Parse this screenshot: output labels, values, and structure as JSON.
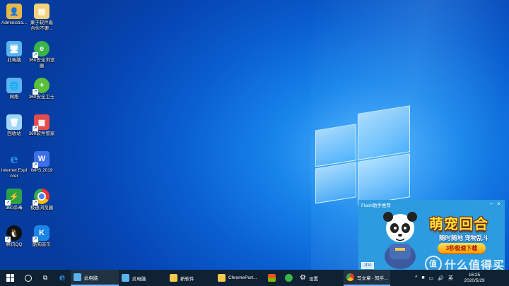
{
  "desktop_icons": [
    {
      "label": "Administra...",
      "icon": "user-folder-icon",
      "color": "#e8b84a"
    },
    {
      "label": "果子软件着 合伙不要...",
      "icon": "folder-icon",
      "color": "#f2d27a"
    },
    {
      "label": "此电脑",
      "icon": "computer-icon",
      "color": "#5ab4f0"
    },
    {
      "label": "360安全浏览器",
      "icon": "browser-360-icon",
      "color": "#3bb54a"
    },
    {
      "label": "网络",
      "icon": "network-icon",
      "color": "#5ab4f0"
    },
    {
      "label": "360安全卫士",
      "icon": "security-360-icon",
      "color": "#58c03a"
    },
    {
      "label": "回收站",
      "icon": "recycle-bin-icon",
      "color": "#9fd6f7"
    },
    {
      "label": "360软件管家",
      "icon": "software-manager-icon",
      "color": "#e64b4b"
    },
    {
      "label": "Internet Explorer",
      "icon": "ie-icon",
      "color": "#2a8de0"
    },
    {
      "label": "WPS 2019",
      "icon": "wps-icon",
      "color": "#3d6fe8"
    },
    {
      "label": "360杀毒",
      "icon": "antivirus-icon",
      "color": "#2fa04a"
    },
    {
      "label": "极速浏览器",
      "icon": "chrome-icon",
      "color": "#e5a823"
    },
    {
      "label": "腾讯QQ",
      "icon": "qq-icon",
      "color": "#111111"
    },
    {
      "label": "酷狗音乐",
      "icon": "kugou-icon",
      "color": "#1b85e5"
    }
  ],
  "popup": {
    "title": "Flash助手推荐",
    "logo_text": "萌宠回合",
    "subtitle": "随时随地 宠物乱斗",
    "button": "3秒极速下载",
    "badge": "1110",
    "close_icon": "close-icon",
    "minimize_icon": "minimize-icon"
  },
  "taskbar": {
    "items": [
      {
        "label": "此电脑",
        "icon": "computer-icon",
        "color": "#5ab4f0"
      },
      {
        "label": "此电脑",
        "icon": "computer-icon",
        "color": "#5ab4f0"
      },
      {
        "label": "新软件",
        "icon": "folder-icon",
        "color": "#f2c94c"
      },
      {
        "label": "ChromePort...",
        "icon": "folder-icon",
        "color": "#f2c94c"
      },
      {
        "label": "",
        "icon": "store-icon",
        "color": "#ffffff"
      },
      {
        "label": "",
        "icon": "browser-360-icon",
        "color": "#3bb54a"
      },
      {
        "label": "设置",
        "icon": "gear-icon",
        "color": "#ffffff"
      },
      {
        "label": "写文章 - 知乎...",
        "icon": "chrome-icon",
        "color": "#e5a823"
      }
    ],
    "ime": "英",
    "clock_time": "16:25",
    "clock_date": "2020/5/29"
  },
  "watermark": "值 什么值得买"
}
